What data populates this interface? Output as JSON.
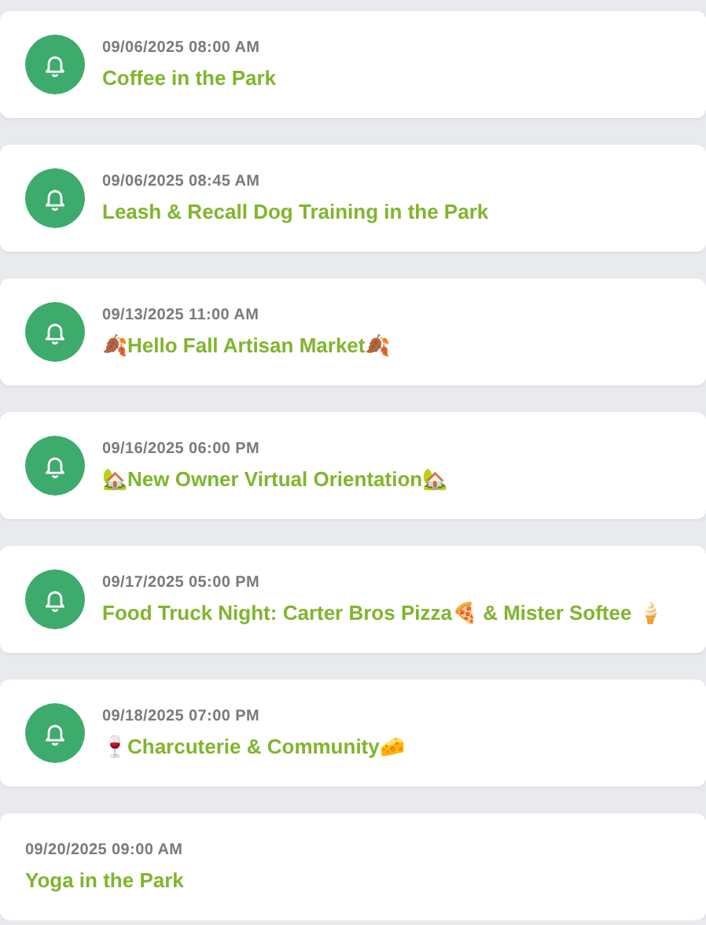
{
  "events": [
    {
      "kind": "reminder",
      "datetime": "09/06/2025 08:00 AM",
      "title": "Coffee in the Park"
    },
    {
      "kind": "reminder",
      "datetime": "09/06/2025 08:45 AM",
      "title": "Leash & Recall Dog Training in the Park"
    },
    {
      "kind": "reminder",
      "datetime": "09/13/2025 11:00 AM",
      "title": "🍂Hello Fall Artisan Market🍂"
    },
    {
      "kind": "reminder",
      "datetime": "09/16/2025 06:00 PM",
      "title": "🏡New Owner Virtual Orientation🏡"
    },
    {
      "kind": "reminder",
      "datetime": "09/17/2025 05:00 PM",
      "title": "Food Truck Night: Carter Bros Pizza🍕 & Mister Softee 🍦"
    },
    {
      "kind": "reminder",
      "datetime": "09/18/2025 07:00 PM",
      "title": "🍷Charcuterie & Community🧀"
    },
    {
      "kind": "plain",
      "datetime": "09/20/2025 09:00 AM",
      "title": "Yoga in the Park"
    }
  ]
}
